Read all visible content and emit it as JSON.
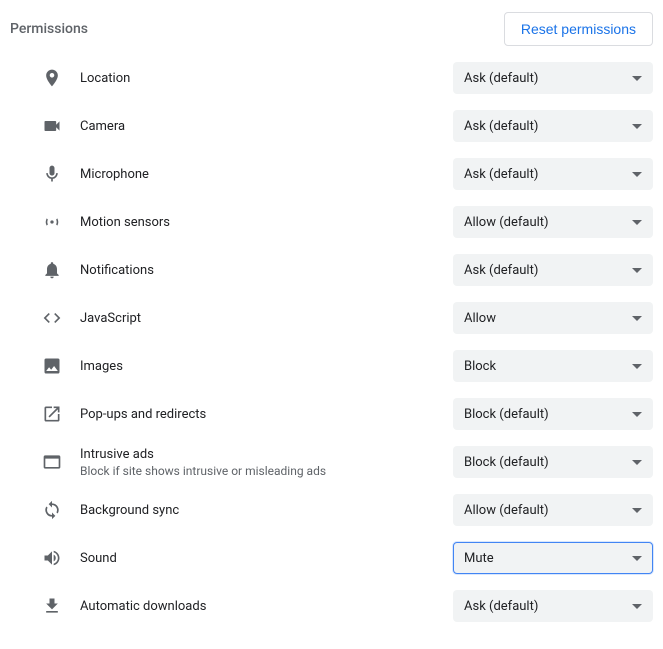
{
  "header": {
    "title": "Permissions",
    "reset_label": "Reset permissions"
  },
  "permissions": [
    {
      "id": "location",
      "icon": "location-icon",
      "label": "Location",
      "value": "Ask (default)"
    },
    {
      "id": "camera",
      "icon": "camera-icon",
      "label": "Camera",
      "value": "Ask (default)"
    },
    {
      "id": "microphone",
      "icon": "microphone-icon",
      "label": "Microphone",
      "value": "Ask (default)"
    },
    {
      "id": "motion-sensors",
      "icon": "motion-sensors-icon",
      "label": "Motion sensors",
      "value": "Allow (default)"
    },
    {
      "id": "notifications",
      "icon": "notifications-icon",
      "label": "Notifications",
      "value": "Ask (default)"
    },
    {
      "id": "javascript",
      "icon": "javascript-icon",
      "label": "JavaScript",
      "value": "Allow"
    },
    {
      "id": "images",
      "icon": "images-icon",
      "label": "Images",
      "value": "Block"
    },
    {
      "id": "popups",
      "icon": "popups-icon",
      "label": "Pop-ups and redirects",
      "value": "Block (default)"
    },
    {
      "id": "intrusive-ads",
      "icon": "ads-icon",
      "label": "Intrusive ads",
      "sublabel": "Block if site shows intrusive or misleading ads",
      "value": "Block (default)"
    },
    {
      "id": "background-sync",
      "icon": "sync-icon",
      "label": "Background sync",
      "value": "Allow (default)"
    },
    {
      "id": "sound",
      "icon": "sound-icon",
      "label": "Sound",
      "value": "Mute",
      "focused": true
    },
    {
      "id": "automatic-downloads",
      "icon": "downloads-icon",
      "label": "Automatic downloads",
      "value": "Ask (default)"
    }
  ]
}
